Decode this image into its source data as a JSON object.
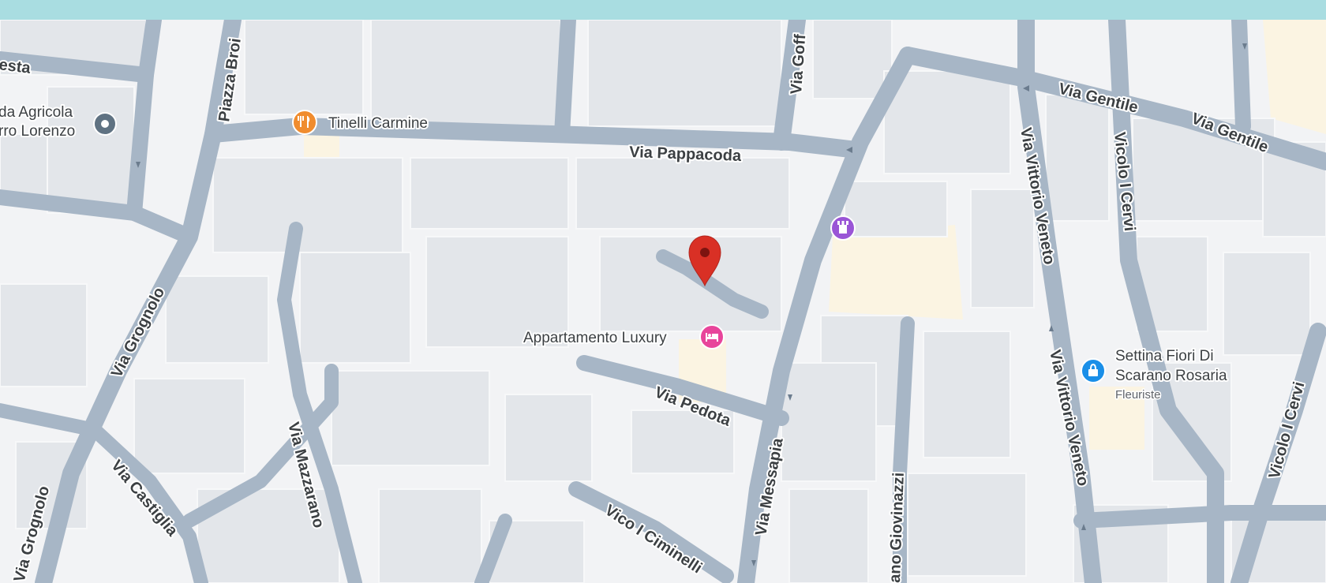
{
  "colors": {
    "top_bar": "#a9dde1",
    "road": "#a7b6c6",
    "building": "#e3e6ea",
    "background": "#f2f3f5",
    "highlight_area": "#fbf4e2",
    "pin": "#d93025",
    "restaurant_poi": "#f08c2e",
    "lodging_poi": "#e8459b",
    "landmark_poi": "#9a55d6",
    "shop_poi": "#1a8fe8",
    "generic_poi": "#5f7282"
  },
  "streets": {
    "via_pappacoda": "Via Pappacoda",
    "via_gentile_1": "Via Gentile",
    "via_gentile_2": "Via Gentile",
    "via_vittorio_veneto_1": "Via Vittorio Veneto",
    "via_vittorio_veneto_2": "Via Vittorio Veneto",
    "vicolo_i_cervi_1": "Vicolo I Cervi",
    "vicolo_i_cervi_2": "Vicolo I Cervi",
    "via_grognolo_1": "Via Grognolo",
    "via_grognolo_2": "Via Grognolo",
    "via_castiglia": "Via Castiglia",
    "via_mazzarano": "Via Mazzarano",
    "via_pedota": "Via Pedota",
    "via_messapia": "Via Messapia",
    "vico_i_ciminelli": "Vico I Ciminelli",
    "giovinazzi_partial": "ano Giovinazzi",
    "via_goff_partial": "Via Goff",
    "piazza_broi_partial": "Piazza Broi",
    "via_top_left_partial": "esta"
  },
  "pois": {
    "tinelli_carmine": {
      "label": "Tinelli Carmine",
      "icon": "fork-knife-icon"
    },
    "appartamento_luxury": {
      "label": "Appartamento Luxury",
      "icon": "bed-icon"
    },
    "settina_fiori": {
      "line1": "Settina Fiori Di",
      "line2": "Scarano Rosaria",
      "category": "Fleuriste",
      "icon": "shopping-bag-icon"
    },
    "azienda_agricola": {
      "line1": "da Agricola",
      "line2": "rro Lorenzo",
      "icon": "map-pin-icon"
    },
    "landmark": {
      "icon": "castle-tower-icon"
    }
  },
  "selected_pin": {
    "icon": "red-location-pin-icon"
  }
}
